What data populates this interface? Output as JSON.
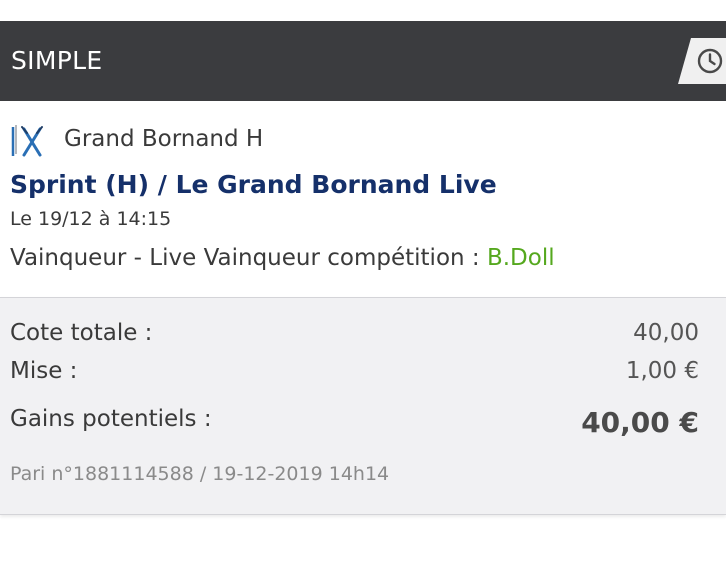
{
  "header": {
    "title": "SIMPLE",
    "history_icon": "clock-icon"
  },
  "event": {
    "sport_icon": "ski-icon",
    "competition": "Grand Bornand H",
    "title": "Sprint (H) / Le Grand Bornand Live",
    "date": "Le 19/12 à 14:15",
    "market": "Vainqueur - Live Vainqueur compétition : ",
    "selection": "B.Doll"
  },
  "summary": {
    "odds_label": "Cote totale :",
    "odds_value": "40,00",
    "stake_label": "Mise :",
    "stake_value": "1,00 €",
    "gains_label": "Gains potentiels :",
    "gains_value": "40,00 €",
    "bet_reference": "Pari n°1881114588 / 19-12-2019 14h14"
  },
  "colors": {
    "header_bg": "#3b3c3f",
    "title_blue": "#15306a",
    "selection_green": "#55a81e",
    "summary_bg": "#f1f1f3"
  }
}
